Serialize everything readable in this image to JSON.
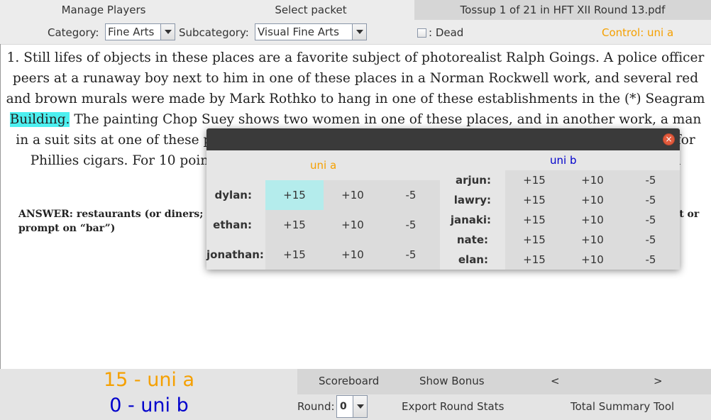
{
  "tabs": {
    "manage_players": "Manage Players",
    "select_packet": "Select packet",
    "tossup_info": "Tossup 1 of 21 in HFT XII Round 13.pdf"
  },
  "filter": {
    "category_label": "Category:",
    "category_value": "Fine Arts",
    "subcategory_label": "Subcategory:",
    "subcategory_value": "Visual Fine Arts",
    "dead_label": ": Dead",
    "dead_checked": false,
    "control": "Control: uni a"
  },
  "question": {
    "before_highlight": "1. Still lifes of objects in these places are a favorite subject of photorealist Ralph Goings. A police officer peers  at a runaway boy next to him in one of these places in a Norman Rockwell work, and several red and brown  murals were made by Mark Rothko to hang in one of these establishments in the (*) Seagram ",
    "highlight": "Building.",
    "after_highlight": " The  painting Chop Suey shows two women in one of these places, and in another work, a man in a suit sits at one of these places, which has a window facing the streets, above which sits a sign for Phillies cigars. For 10 points, name these eating establishments, an example of which is shown in Nighthawks.",
    "answer": "ANSWER: restaurants (or diners; accept cafes; accept cafeterias; accept Automat; accept luncheonettes; d o not accept or prompt on “bar”)"
  },
  "popup": {
    "close_glyph": "×",
    "team_a": {
      "name": "uni a",
      "color": "#f5a000",
      "players": [
        {
          "name": "dylan:",
          "buttons": [
            "+15",
            "+10",
            "-5"
          ],
          "selected": "+15"
        },
        {
          "name": "ethan:",
          "buttons": [
            "+15",
            "+10",
            "-5"
          ],
          "selected": null
        },
        {
          "name": "jonathan:",
          "buttons": [
            "+15",
            "+10",
            "-5"
          ],
          "selected": null
        }
      ]
    },
    "team_b": {
      "name": "uni b",
      "color": "#0000cc",
      "players": [
        {
          "name": "arjun:",
          "buttons": [
            "+15",
            "+10",
            "-5"
          ]
        },
        {
          "name": "lawry:",
          "buttons": [
            "+15",
            "+10",
            "-5"
          ]
        },
        {
          "name": "janaki:",
          "buttons": [
            "+15",
            "+10",
            "-5"
          ]
        },
        {
          "name": "nate:",
          "buttons": [
            "+15",
            "+10",
            "-5"
          ]
        },
        {
          "name": "elan:",
          "buttons": [
            "+15",
            "+10",
            "-5"
          ]
        }
      ]
    }
  },
  "scores": {
    "team_a": "15 - uni a",
    "team_b": "0 - uni b"
  },
  "bottom": {
    "scoreboard": "Scoreboard",
    "show_bonus": "Show Bonus",
    "prev": "<",
    "next": ">",
    "round_label": "Round:",
    "round_value": "0",
    "export": "Export Round Stats",
    "summary": "Total Summary Tool"
  }
}
